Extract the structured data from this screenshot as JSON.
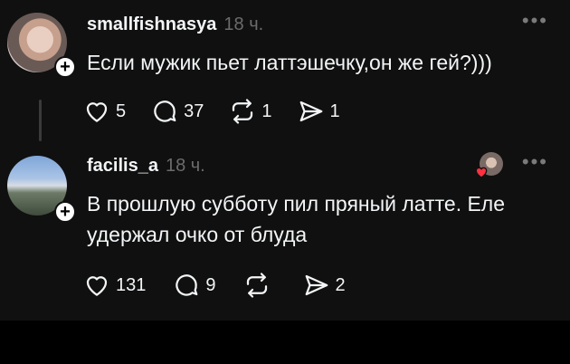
{
  "posts": [
    {
      "username": "smallfishnasya",
      "time": "18 ч.",
      "text": "Если мужик пьет латтэшечку,он же гей?)))",
      "likes": "5",
      "replies": "37",
      "reposts": "1",
      "shares": "1",
      "avatar_icon": "profile-photo"
    },
    {
      "username": "facilis_a",
      "time": "18 ч.",
      "text": "В прошлую субботу пил пряный латте. Еле удержал очко от блуда",
      "likes": "131",
      "replies": "9",
      "reposts": "",
      "shares": "2",
      "avatar_icon": "profile-photo"
    }
  ],
  "colors": {
    "background": "#101010",
    "text": "#f3f5f7",
    "muted": "#6b6b6b",
    "heart": "#ff3040"
  },
  "icons": {
    "more": "•••",
    "follow": "+"
  }
}
